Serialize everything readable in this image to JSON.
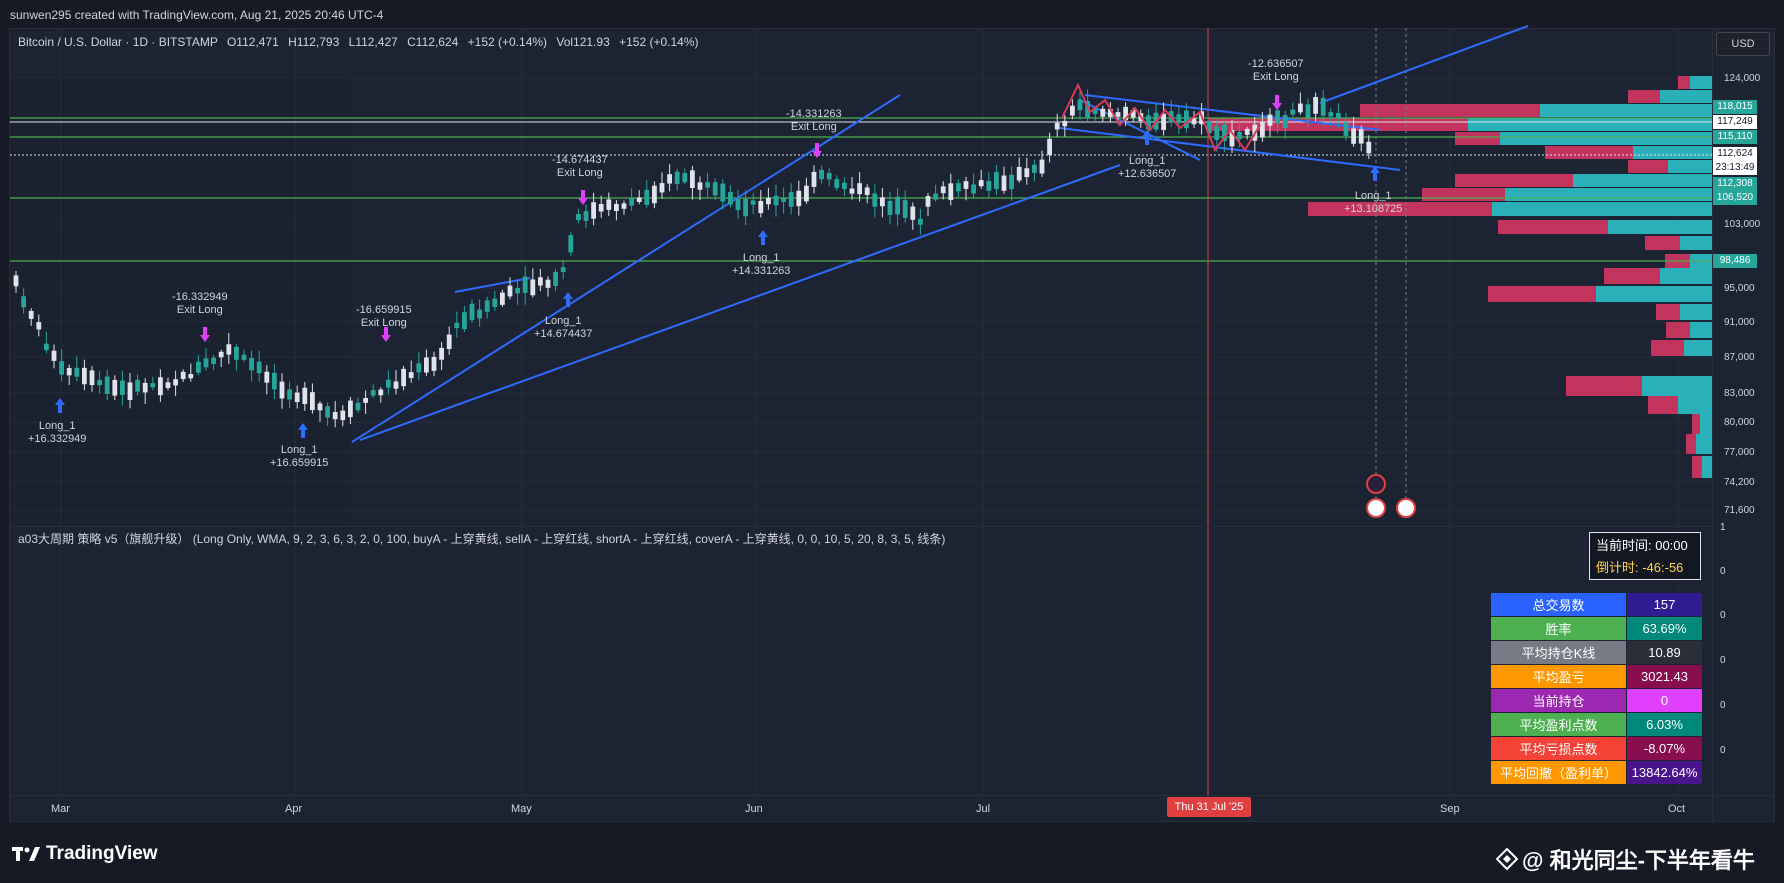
{
  "header": {
    "created_by": "sunwen295 created with TradingView.com, Aug 21, 2025 20:46 UTC-4"
  },
  "symbol": {
    "name": "Bitcoin / U.S. Dollar · 1D · BITSTAMP",
    "open": "O112,471",
    "high": "H112,793",
    "low": "L112,427",
    "close": "C112,624",
    "change": "+152 (+0.14%)",
    "vol": "Vol121.93",
    "vol_change": "+152 (+0.14%)"
  },
  "currency_button": "USD",
  "indicator_line": "a03大周期 策略 v5（旗舰升级） (Long Only, WMA, 9, 2, 3, 6, 3, 2, 0, 100, buyA - 上穿黄线, sellA - 上穿红线, shortA - 上穿红线, coverA - 上穿黄线, 0, 0, 10, 5, 20, 8, 3, 5, 线条)",
  "clock": {
    "now": "当前时间:  00:00",
    "countdown": "倒计时:  -46:-56"
  },
  "stats": [
    {
      "key": "总交易数",
      "value": "157",
      "kcolor": "#2962ff",
      "vcolor": "#311b92"
    },
    {
      "key": "胜率",
      "value": "63.69%",
      "kcolor": "#4caf50",
      "vcolor": "#00897b"
    },
    {
      "key": "平均持仓K线",
      "value": "10.89",
      "kcolor": "#787b86",
      "vcolor": "#2a2e39"
    },
    {
      "key": "平均盈亏",
      "value": "3021.43",
      "kcolor": "#ff9800",
      "vcolor": "#880e4f"
    },
    {
      "key": "当前持仓",
      "value": "0",
      "kcolor": "#9c27b0",
      "vcolor": "#e040fb"
    },
    {
      "key": "平均盈利点数",
      "value": "6.03%",
      "kcolor": "#4caf50",
      "vcolor": "#00897b"
    },
    {
      "key": "平均亏损点数",
      "value": "-8.07%",
      "kcolor": "#f44336",
      "vcolor": "#880e4f"
    },
    {
      "key": "平均回撤（盈利单）",
      "value": "13842.64%",
      "kcolor": "#ff9800",
      "vcolor": "#4a148c"
    }
  ],
  "y_axis": [
    "124,000",
    "103,000",
    "95,000",
    "91,000",
    "87,000",
    "83,000",
    "80,000",
    "77,000",
    "74,200",
    "71,600"
  ],
  "price_tags": [
    {
      "label": "118,015",
      "color": "#26a69a"
    },
    {
      "label": "117,249",
      "color": "#ffffff"
    },
    {
      "label": "115,110",
      "color": "#26a69a"
    },
    {
      "label": "112,624",
      "color": "#ffffff"
    },
    {
      "label": "23:13:49",
      "color": "#ffffff"
    },
    {
      "label": "112,308",
      "color": "#26a69a"
    },
    {
      "label": "106,520",
      "color": "#26a69a"
    },
    {
      "label": "98,486",
      "color": "#26a69a"
    }
  ],
  "ind_axis": [
    "1",
    "0",
    "0",
    "0",
    "0",
    "0"
  ],
  "x_axis": [
    "Mar",
    "Apr",
    "May",
    "Jun",
    "Jul",
    "Sep",
    "Oct"
  ],
  "date_flag": "Thu 31 Jul '25",
  "trades": [
    {
      "l1": "Long_1",
      "l2": "+16.332949"
    },
    {
      "l1": "-16.332949",
      "l2": "Exit Long"
    },
    {
      "l1": "Long_1",
      "l2": "+16.659915"
    },
    {
      "l1": "-16.659915",
      "l2": "Exit Long"
    },
    {
      "l1": "Long_1",
      "l2": "+14.674437"
    },
    {
      "l1": "-14.674437",
      "l2": "Exit Long"
    },
    {
      "l1": "Long_1",
      "l2": "+14.331263"
    },
    {
      "l1": "-14.331263",
      "l2": "Exit Long"
    },
    {
      "l1": "Long_1",
      "l2": "+12.636507"
    },
    {
      "l1": "-12.636507",
      "l2": "Exit Long"
    },
    {
      "l1": "Long_1",
      "l2": "+13.108725"
    }
  ],
  "brand": "TradingView",
  "watermark": "@ 和光同尘-下半年看牛"
}
